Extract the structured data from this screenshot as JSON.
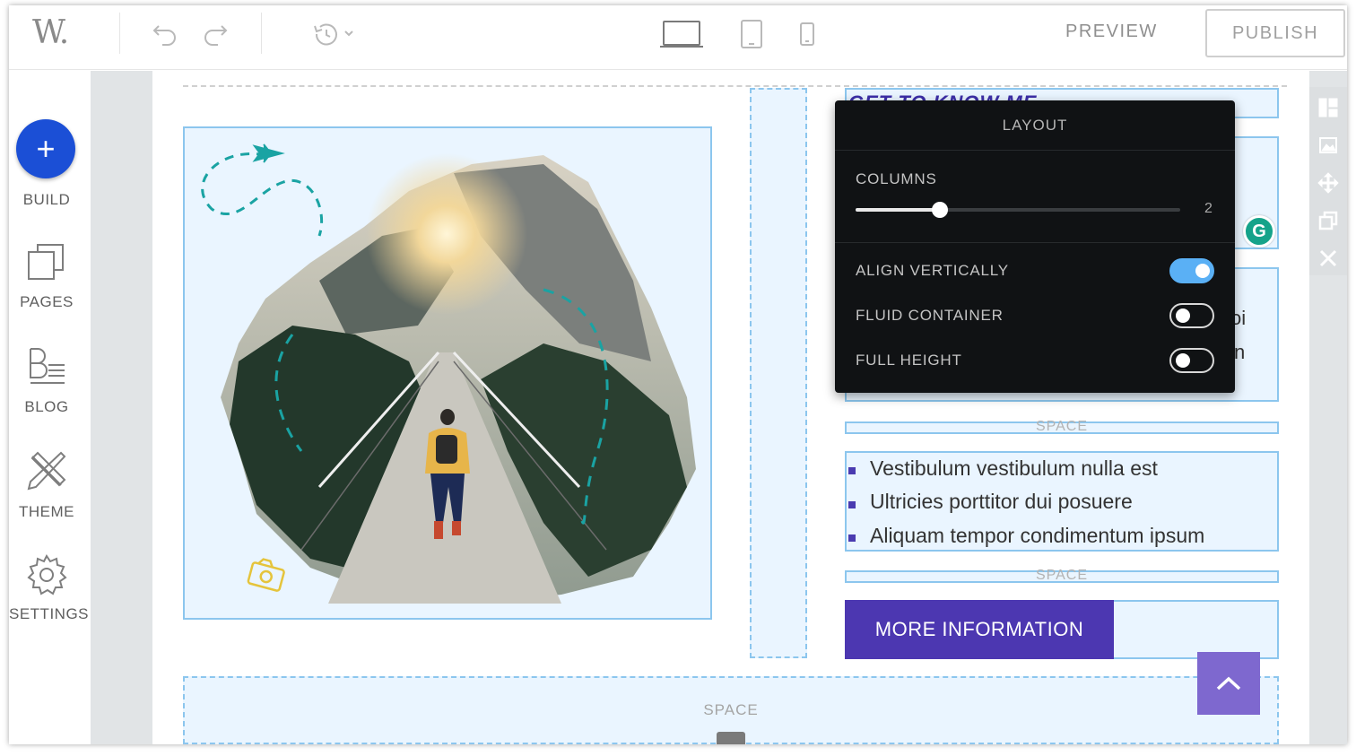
{
  "toolbar": {
    "logo": "W.",
    "preview_label": "PREVIEW",
    "publish_label": "PUBLISH",
    "undo_icon": "undo-icon",
    "redo_icon": "redo-icon",
    "history_icon": "history-icon",
    "devices": [
      "desktop-icon",
      "tablet-icon",
      "mobile-icon"
    ]
  },
  "sidebar": {
    "items": [
      {
        "label": "BUILD",
        "icon": "plus-icon"
      },
      {
        "label": "PAGES",
        "icon": "pages-icon"
      },
      {
        "label": "BLOG",
        "icon": "blog-icon"
      },
      {
        "label": "THEME",
        "icon": "theme-icon"
      },
      {
        "label": "SETTINGS",
        "icon": "gear-icon"
      }
    ]
  },
  "layout_panel": {
    "title": "LAYOUT",
    "columns_label": "COLUMNS",
    "columns_value": "2",
    "columns_slider_fraction": 0.26,
    "align_vertically_label": "ALIGN VERTICALLY",
    "align_vertically_on": true,
    "fluid_container_label": "FLUID CONTAINER",
    "fluid_container_on": false,
    "full_height_label": "FULL HEIGHT",
    "full_height_on": false
  },
  "content": {
    "space_label": "SPACE",
    "list_items": [
      "Vestibulum vestibulum nulla est",
      "Ultricies porttitor dui posuere",
      "Aliquam tempor condimentum ipsum"
    ],
    "more_button_label": "MORE INFORMATION",
    "peek_text_1": "oi",
    "peek_text_2": "n"
  },
  "right_tools": [
    "layout-icon",
    "image-icon",
    "move-icon",
    "duplicate-icon",
    "close-icon"
  ],
  "colors": {
    "accent_blue": "#1b4fd6",
    "button_purple": "#4c37b1",
    "toggle_on": "#5ab0f5",
    "panel_bg": "#101214"
  }
}
